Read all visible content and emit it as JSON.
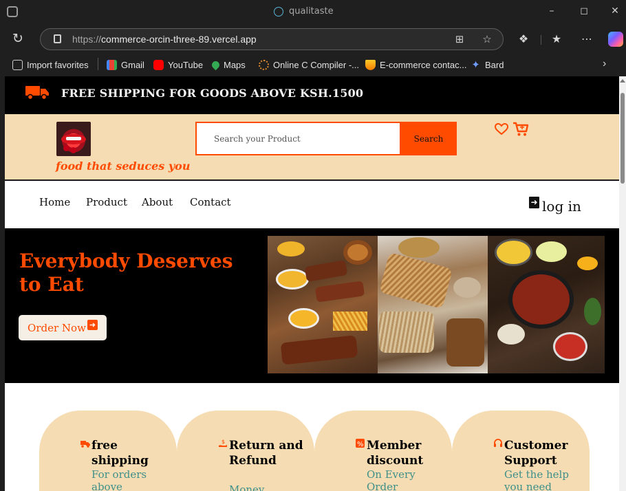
{
  "browser": {
    "tab_title": "qualitaste",
    "url_protocol": "https://",
    "url_host": "commerce-orcin-three-89.vercel.app",
    "favorites": [
      {
        "label": "Import favorites",
        "icon": "import-icon"
      },
      {
        "label": "Gmail",
        "icon": "gmail-icon"
      },
      {
        "label": "YouTube",
        "icon": "youtube-icon"
      },
      {
        "label": "Maps",
        "icon": "maps-icon"
      },
      {
        "label": "Online C Compiler -...",
        "icon": "compiler-icon"
      },
      {
        "label": "E-commerce contac...",
        "icon": "firebase-icon"
      },
      {
        "label": "Bard",
        "icon": "bard-icon"
      }
    ]
  },
  "page": {
    "shipping_banner": "FREE SHIPPING FOR GOODS ABOVE KSH.1500",
    "tagline": "food that seduces you",
    "search": {
      "placeholder": "Search your Product",
      "button": "Search"
    },
    "nav": [
      "Home",
      "Product",
      "About",
      "Contact"
    ],
    "login": "log in",
    "hero": {
      "headline": "Everybody Deserves to Eat",
      "cta": "Order Now"
    },
    "features": [
      {
        "title": "free shipping",
        "sub": "For orders above",
        "icon": "truck-icon"
      },
      {
        "title": "Return and Refund",
        "sub": "Money",
        "icon": "refund-icon"
      },
      {
        "title": "Member discount",
        "sub": "On Every Order",
        "icon": "percent-icon"
      },
      {
        "title": "Customer Support",
        "sub": "Get the help you need",
        "icon": "headset-icon"
      }
    ],
    "colors": {
      "accent": "#ff4b00",
      "header_bg": "#f5dcb2",
      "card_sub": "#3f8f8a"
    }
  }
}
